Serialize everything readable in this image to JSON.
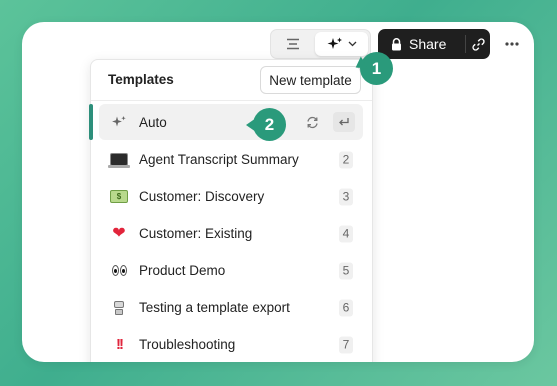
{
  "toolbar": {
    "layout_icon": "align-lines-icon",
    "ai_icon": "sparkles-icon",
    "chevron_icon": "chevron-down-icon",
    "share_label": "Share",
    "lock_icon": "lock-icon",
    "link_icon": "link-icon",
    "more_icon": "more-horizontal-icon"
  },
  "dropdown": {
    "title": "Templates",
    "new_template_label": "New template",
    "items": [
      {
        "label": "Auto",
        "icon": "sparkles-icon",
        "actions": [
          "refresh-icon",
          "enter-icon"
        ]
      },
      {
        "label": "Agent Transcript Summary",
        "icon": "laptop-icon",
        "key": "2"
      },
      {
        "label": "Customer: Discovery",
        "icon": "money-icon",
        "key": "3"
      },
      {
        "label": "Customer: Existing",
        "icon": "heart-icon",
        "key": "4"
      },
      {
        "label": "Product Demo",
        "icon": "eyes-icon",
        "key": "5"
      },
      {
        "label": "Testing a template export",
        "icon": "robot-icon",
        "key": "6"
      },
      {
        "label": "Troubleshooting",
        "icon": "exclamation-icon",
        "key": "7"
      }
    ]
  },
  "callouts": {
    "one": "1",
    "two": "2"
  },
  "colors": {
    "accent": "#2a9a7b",
    "share_bg": "#1f1f1f",
    "frame": "#4cb892"
  }
}
